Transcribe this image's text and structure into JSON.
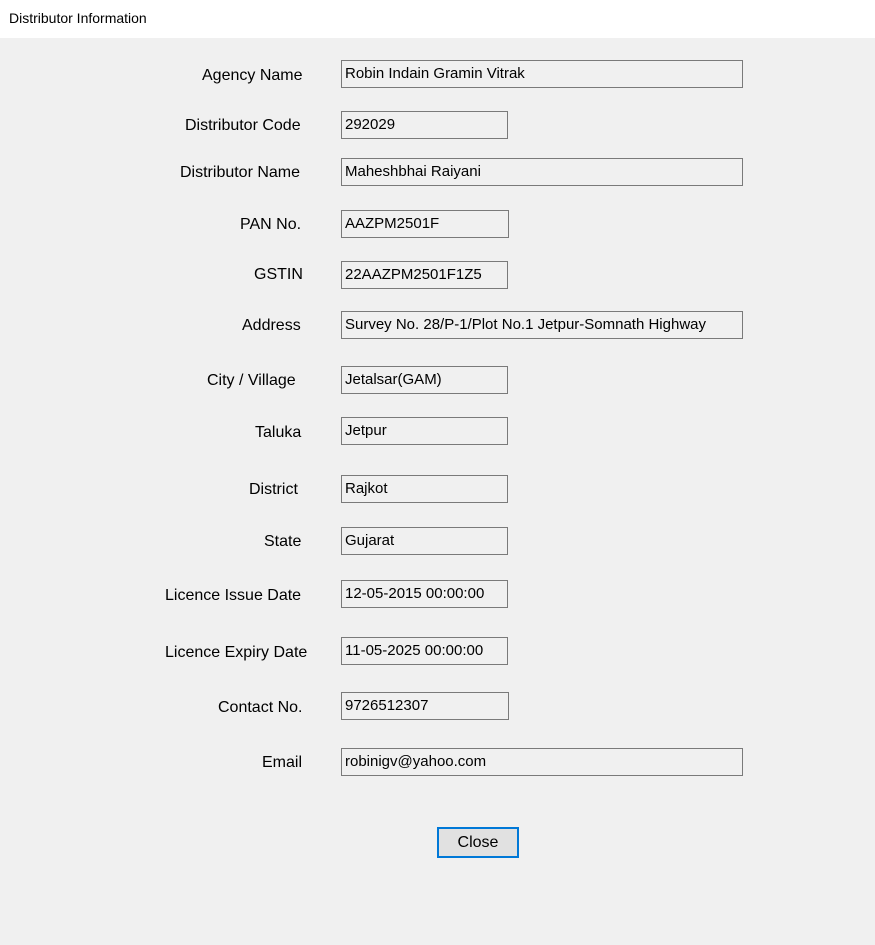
{
  "window": {
    "title": "Distributor Information"
  },
  "form": {
    "agency_name": {
      "label": "Agency Name",
      "value": "Robin Indain Gramin Vitrak"
    },
    "distributor_code": {
      "label": "Distributor Code",
      "value": "292029"
    },
    "distributor_name": {
      "label": "Distributor Name",
      "value": "Maheshbhai Raiyani"
    },
    "pan_no": {
      "label": "PAN No.",
      "value": "AAZPM2501F"
    },
    "gstin": {
      "label": "GSTIN",
      "value": "22AAZPM2501F1Z5"
    },
    "address": {
      "label": "Address",
      "value": "Survey No. 28/P-1/Plot No.1 Jetpur-Somnath Highway"
    },
    "city_village": {
      "label": "City / Village",
      "value": "Jetalsar(GAM)"
    },
    "taluka": {
      "label": "Taluka",
      "value": "Jetpur"
    },
    "district": {
      "label": "District",
      "value": "Rajkot"
    },
    "state": {
      "label": "State",
      "value": "Gujarat"
    },
    "licence_issue_date": {
      "label": "Licence Issue Date",
      "value": "12-05-2015 00:00:00"
    },
    "licence_expiry_date": {
      "label": "Licence Expiry Date",
      "value": "11-05-2025 00:00:00"
    },
    "contact_no": {
      "label": "Contact No.",
      "value": "9726512307"
    },
    "email": {
      "label": "Email",
      "value": "robinigv@yahoo.com"
    }
  },
  "buttons": {
    "close_label": "Close"
  },
  "colors": {
    "client_background": "#f0f0f0",
    "field_border": "#7a7a7a",
    "button_focus_border": "#0078d7",
    "button_background": "#e1e1e1"
  }
}
